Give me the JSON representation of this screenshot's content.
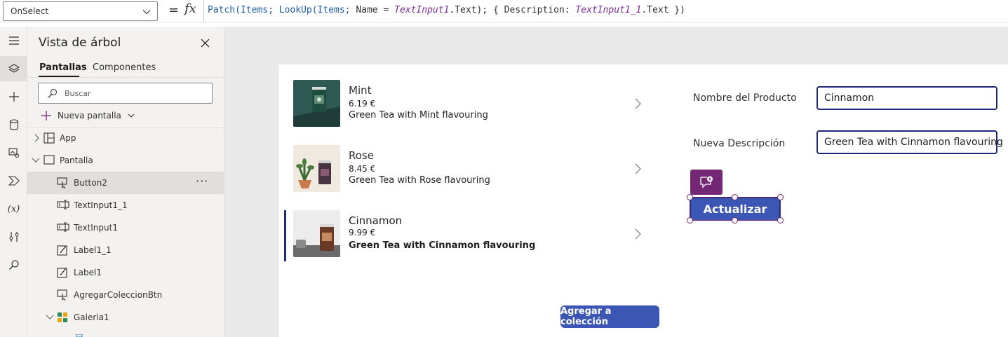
{
  "formula_bar": {
    "property": "OnSelect",
    "formula_tokens": {
      "t1": "Patch(Items; LookUp(Items; ",
      "t2": "Name = ",
      "t3": "TextInput1",
      "t4": ".Text); { Description: ",
      "t5": "TextInput1_1",
      "t6": ".Text })"
    }
  },
  "tree_panel": {
    "title": "Vista de árbol",
    "tabs": [
      {
        "label": "Pantallas"
      },
      {
        "label": "Componentes"
      }
    ],
    "search_placeholder": "Buscar",
    "new_screen_label": "Nueva pantalla",
    "nodes": [
      {
        "label": "App"
      },
      {
        "label": "Pantalla"
      },
      {
        "label": "Button2"
      },
      {
        "label": "TextInput1_1"
      },
      {
        "label": "TextInput1"
      },
      {
        "label": "Label1_1"
      },
      {
        "label": "Label1"
      },
      {
        "label": "AgregarColeccionBtn"
      },
      {
        "label": "Galeria1"
      }
    ]
  },
  "gallery": {
    "items": [
      {
        "title": "Mint",
        "price": "6.19 €",
        "description": "Green Tea with Mint flavouring"
      },
      {
        "title": "Rose",
        "price": "8.45 €",
        "description": "Green Tea with Rose flavouring"
      },
      {
        "title": "Cinnamon",
        "price": "9.99 €",
        "description": "Green Tea with Cinnamon flavouring"
      }
    ]
  },
  "form": {
    "product_name_label": "Nombre del Producto",
    "product_name_value": "Cinnamon",
    "new_description_label": "Nueva Descripción",
    "new_description_value": "Green Tea with Cinnamon flavouring",
    "update_button": "Actualizar"
  },
  "add_to_collection_button": "Agregar a colección",
  "colors": {
    "accent_purple": "#742774",
    "button_blue": "#3c56b4",
    "input_border": "#1e2a78"
  }
}
